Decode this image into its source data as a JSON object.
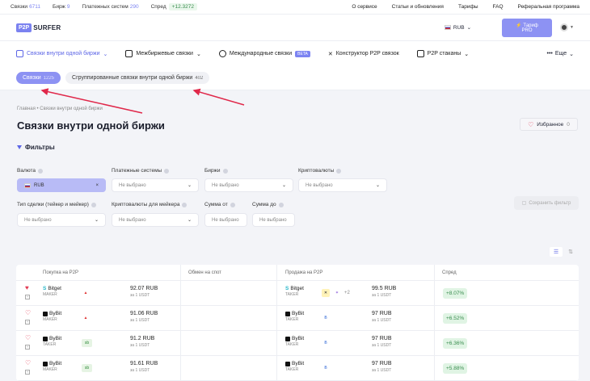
{
  "topbar": {
    "stats": [
      {
        "label": "Связки",
        "value": "6711"
      },
      {
        "label": "Бирж",
        "value": "9"
      },
      {
        "label": "Платежных систем",
        "value": "290"
      }
    ],
    "spread_label": "Спред",
    "spread_value": "+12.3272",
    "links": [
      "О сервисе",
      "Статьи и обновления",
      "Тарифы",
      "FAQ",
      "Реферальная программа"
    ]
  },
  "header": {
    "logo_box": "P2P",
    "logo_text": "SURFER",
    "currency": "RUB",
    "tariff_button": "⚡ Тариф PRO"
  },
  "nav": {
    "items": [
      {
        "label": "Связки внутри одной биржи",
        "active": true
      },
      {
        "label": "Межбиржевые связки",
        "active": false
      },
      {
        "label": "Международные связки",
        "badge": "BETA",
        "active": false
      },
      {
        "label": "Конструктор P2P связок",
        "active": false
      },
      {
        "label": "P2P стаканы",
        "active": false
      }
    ],
    "more": "Еще"
  },
  "subtabs": [
    {
      "label": "Связки",
      "count": "1225",
      "active": true
    },
    {
      "label": "Сгруппированные связки внутри одной биржи",
      "count": "402",
      "active": false
    }
  ],
  "breadcrumb": "Главная • Связки внутри одной биржи",
  "page_title": "Связки внутри одной биржи",
  "favorites": {
    "label": "Избранное",
    "count": "0"
  },
  "filters": {
    "title": "Фильтры",
    "row1": [
      {
        "label": "Валюта",
        "value": "RUB"
      },
      {
        "label": "Платежные системы",
        "value": "Не выбрано"
      },
      {
        "label": "Биржи",
        "value": "Не выбрано"
      },
      {
        "label": "Криптовалюты",
        "value": "Не выбрано"
      }
    ],
    "row2": [
      {
        "label": "Тип сделки (тейкер и мейкер)",
        "value": "Не выбрано"
      },
      {
        "label": "Криптовалюты для мейкера",
        "value": "Не выбрано"
      },
      {
        "label": "Сумма от",
        "value": "Не выбрано"
      },
      {
        "label": "Сумма до",
        "value": "Не выбрано"
      }
    ],
    "save": "Сохранить фильтр"
  },
  "table": {
    "headers": [
      "Покупка на P2P",
      "Обмен на спот",
      "Продажа на P2P",
      "Спред"
    ],
    "rows": [
      {
        "fav": true,
        "buy_ex": "Bitget",
        "buy_role": "MAKER",
        "buy_price": "92.07 RUB",
        "per": "за 1 USDT",
        "sell_ex": "Bitget",
        "sell_role": "TAKER",
        "sell_extra": "+2",
        "sell_price": "99.5 RUB",
        "spread": "+8.07%"
      },
      {
        "fav": false,
        "buy_ex": "ByBit",
        "buy_role": "MAKER",
        "buy_price": "91.06 RUB",
        "per": "за 1 USDT",
        "sell_ex": "ByBit",
        "sell_role": "TAKER",
        "sell_extra": "",
        "sell_price": "97 RUB",
        "spread": "+6.52%"
      },
      {
        "fav": false,
        "buy_ex": "ByBit",
        "buy_role": "TAKER",
        "buy_price": "91.2 RUB",
        "per": "за 1 USDT",
        "sell_ex": "ByBit",
        "sell_role": "TAKER",
        "sell_extra": "",
        "sell_price": "97 RUB",
        "spread": "+6.36%"
      },
      {
        "fav": false,
        "buy_ex": "ByBit",
        "buy_role": "MAKER",
        "buy_price": "91.61 RUB",
        "per": "за 1 USDT",
        "sell_ex": "ByBit",
        "sell_role": "TAKER",
        "sell_extra": "",
        "sell_price": "97 RUB",
        "spread": "+5.88%"
      }
    ]
  },
  "colors": {
    "accent": "#7c84f2",
    "heart": "#e23b54",
    "positive": "#3a8d4f"
  }
}
